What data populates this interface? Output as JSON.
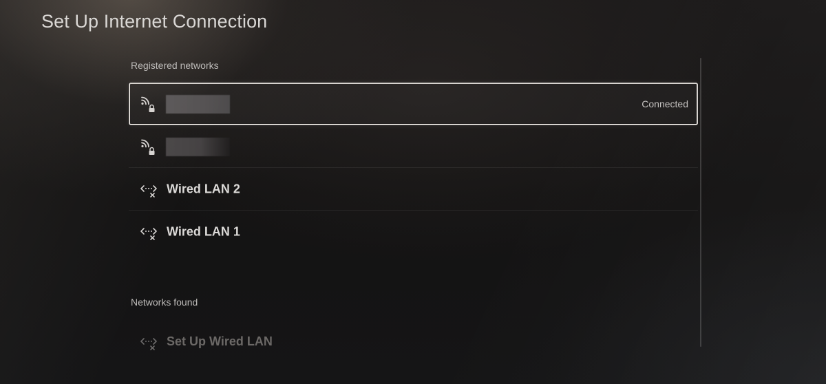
{
  "header": {
    "title": "Set Up Internet Connection"
  },
  "sections": {
    "registered": "Registered networks",
    "found": "Networks found"
  },
  "registered_networks": [
    {
      "type": "wifi",
      "icon": "wifi-lock-icon",
      "name": "",
      "status": "Connected",
      "focused": true
    },
    {
      "type": "wifi",
      "icon": "wifi-lock-icon",
      "name": "",
      "status": ""
    },
    {
      "type": "wired",
      "icon": "wired-lan-disconnected-icon",
      "name": "Wired LAN 2"
    },
    {
      "type": "wired",
      "icon": "wired-lan-disconnected-icon",
      "name": "Wired LAN 1"
    }
  ],
  "networks_found": [
    {
      "icon": "wired-lan-disconnected-icon",
      "label": "Set Up Wired LAN",
      "disabled": true
    }
  ],
  "colors": {
    "background": "#121112",
    "text": "#dcdad8",
    "focus_border": "#d7d3cf",
    "disabled_text": "#6b6866"
  }
}
